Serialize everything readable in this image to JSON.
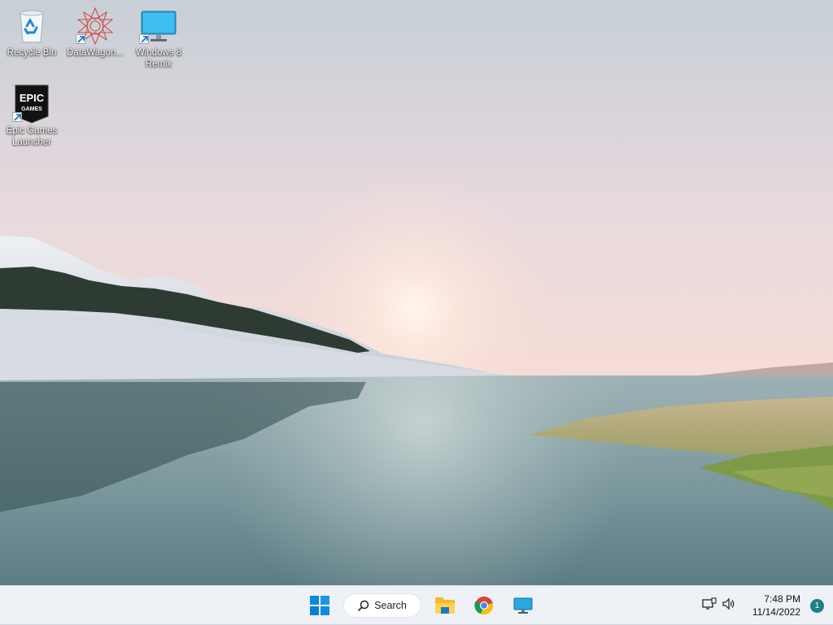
{
  "desktop": {
    "icons": [
      {
        "label": "Recycle Bin",
        "icon": "recycle-bin-icon",
        "shortcut": false
      },
      {
        "label": "DataWagon...",
        "icon": "datawagon-icon",
        "shortcut": true
      },
      {
        "label": "Windows 8 Remix",
        "icon": "monitor-icon",
        "shortcut": true
      },
      {
        "label": "Epic Games Launcher",
        "icon": "epic-games-icon",
        "shortcut": true
      }
    ],
    "epic_logo_text": [
      "EPIC",
      "GAMES"
    ]
  },
  "taskbar": {
    "start_icon": "windows-start-icon",
    "search_label": "Search",
    "apps": [
      {
        "name": "File Explorer",
        "icon": "folder-icon"
      },
      {
        "name": "Google Chrome",
        "icon": "chrome-icon"
      },
      {
        "name": "Remote Desktop",
        "icon": "monitor-icon"
      }
    ],
    "tray": {
      "network_icon": "network-icon",
      "volume_icon": "speaker-icon",
      "time": "7:48 PM",
      "date": "11/14/2022",
      "notification_count": "1"
    }
  },
  "colors": {
    "taskbar_bg": "#eef1f5",
    "accent": "#1d7f87",
    "windows_blue": "#0078d4"
  }
}
